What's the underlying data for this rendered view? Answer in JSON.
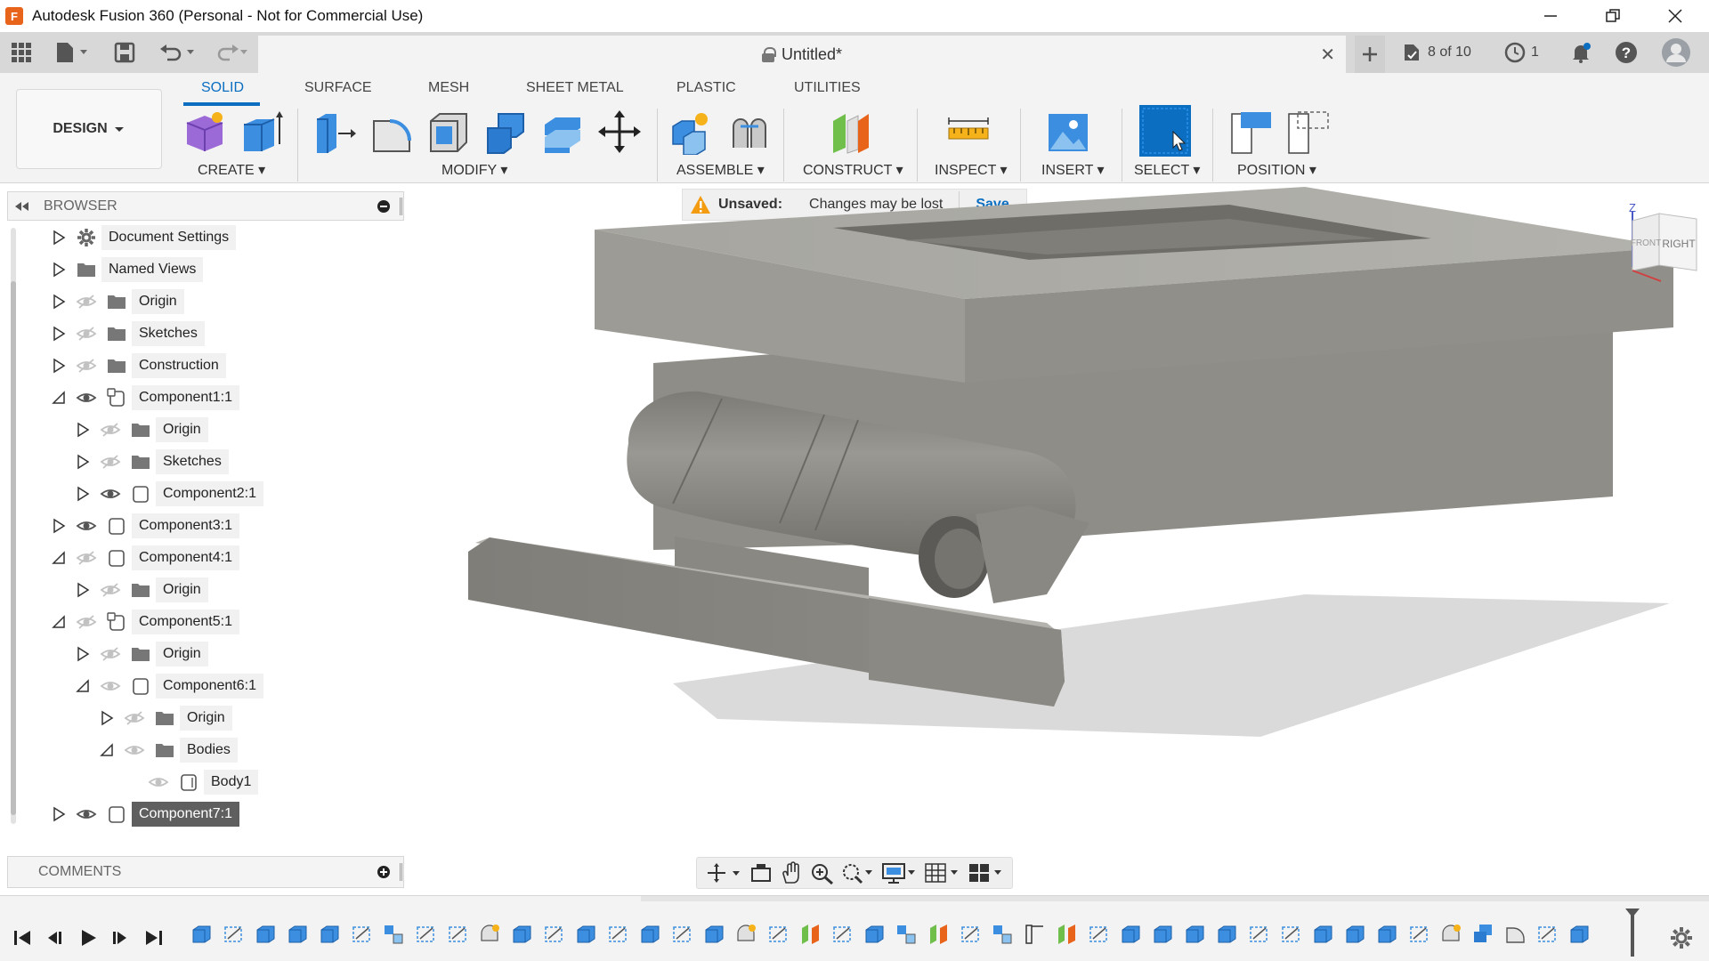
{
  "window": {
    "title": "Autodesk Fusion 360 (Personal - Not for Commercial Use)",
    "logo_letter": "F"
  },
  "tabbar": {
    "doc_title": "Untitled*",
    "job_status": "8 of 10",
    "clock_count": "1"
  },
  "ribbon": {
    "workspace_button": "DESIGN",
    "tabs": [
      "SOLID",
      "SURFACE",
      "MESH",
      "SHEET METAL",
      "PLASTIC",
      "UTILITIES"
    ],
    "active_tab": "SOLID",
    "groups": [
      "CREATE",
      "MODIFY",
      "ASSEMBLE",
      "CONSTRUCT",
      "INSPECT",
      "INSERT",
      "SELECT",
      "POSITION"
    ]
  },
  "browser": {
    "title": "BROWSER",
    "items": [
      {
        "label": "Document Settings",
        "expanded": false,
        "eye": "none",
        "icon": "gear-icon"
      },
      {
        "label": "Named Views",
        "expanded": false,
        "eye": "none",
        "icon": "folder-icon"
      },
      {
        "label": "Origin",
        "expanded": false,
        "eye": "hidden",
        "icon": "folder-icon"
      },
      {
        "label": "Sketches",
        "expanded": false,
        "eye": "hidden",
        "icon": "folder-icon"
      },
      {
        "label": "Construction",
        "expanded": false,
        "eye": "hidden",
        "icon": "folder-icon"
      },
      {
        "label": "Component1:1",
        "expanded": true,
        "eye": "visible",
        "icon": "component-linked-icon"
      },
      {
        "label": "Origin",
        "expanded": false,
        "eye": "hidden",
        "icon": "folder-icon"
      },
      {
        "label": "Sketches",
        "expanded": false,
        "eye": "hidden",
        "icon": "folder-icon"
      },
      {
        "label": "Component2:1",
        "expanded": false,
        "eye": "visible",
        "icon": "component-icon"
      },
      {
        "label": "Component3:1",
        "expanded": false,
        "eye": "visible",
        "icon": "component-icon"
      },
      {
        "label": "Component4:1",
        "expanded": true,
        "eye": "hidden",
        "icon": "component-icon"
      },
      {
        "label": "Origin",
        "expanded": false,
        "eye": "hidden",
        "icon": "folder-icon"
      },
      {
        "label": "Component5:1",
        "expanded": true,
        "eye": "hidden",
        "icon": "component-linked-icon"
      },
      {
        "label": "Origin",
        "expanded": false,
        "eye": "hidden",
        "icon": "folder-icon"
      },
      {
        "label": "Component6:1",
        "expanded": true,
        "eye": "faded",
        "icon": "component-icon"
      },
      {
        "label": "Origin",
        "expanded": false,
        "eye": "hidden",
        "icon": "folder-icon"
      },
      {
        "label": "Bodies",
        "expanded": true,
        "eye": "faded",
        "icon": "folder-icon"
      },
      {
        "label": "Body1",
        "expanded": null,
        "eye": "faded",
        "icon": "body-icon"
      },
      {
        "label": "Component7:1",
        "expanded": false,
        "eye": "visible",
        "icon": "component-icon",
        "selected": true
      }
    ]
  },
  "banner": {
    "title": "Unsaved:",
    "message": "Changes may be lost",
    "action": "Save"
  },
  "viewcube": {
    "axis": "Z",
    "face_right": "RIGHT",
    "face_front": "FRONT"
  },
  "comments": {
    "title": "COMMENTS"
  },
  "colors": {
    "accent": "#0b6ec1",
    "model_gray": "#8f8e88",
    "selected_row": "#5f5f5f"
  }
}
